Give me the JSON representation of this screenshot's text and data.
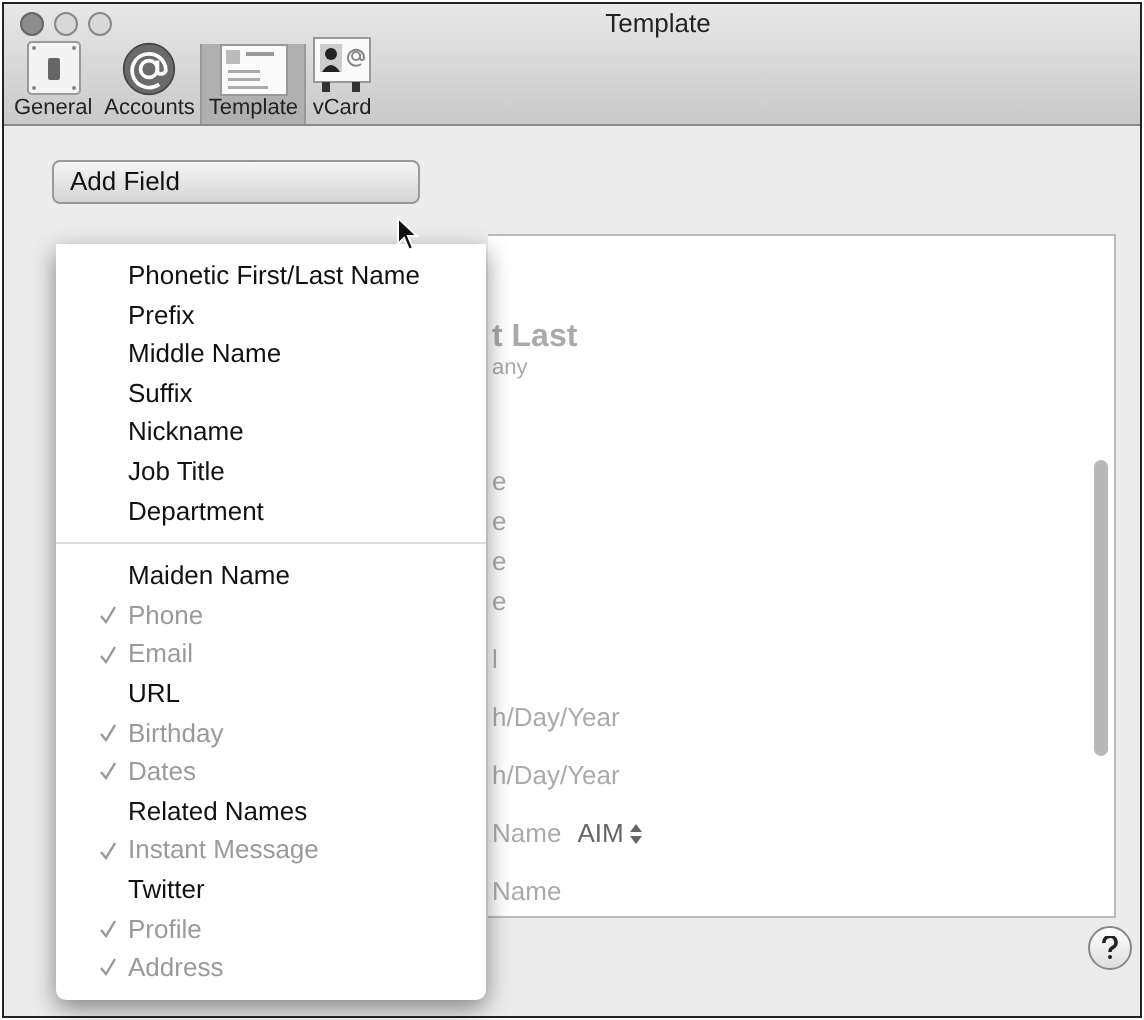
{
  "window": {
    "title": "Template"
  },
  "toolbar": [
    {
      "label": "General",
      "kind": "switch",
      "selected": false
    },
    {
      "label": "Accounts",
      "kind": "at",
      "selected": false
    },
    {
      "label": "Template",
      "kind": "card",
      "selected": true
    },
    {
      "label": "vCard",
      "kind": "vcard",
      "selected": false
    }
  ],
  "add_field": {
    "label": "Add Field"
  },
  "menu": {
    "sections": [
      [
        {
          "label": "Phonetic First/Last Name",
          "checked": false
        },
        {
          "label": "Prefix",
          "checked": false
        },
        {
          "label": "Middle Name",
          "checked": false
        },
        {
          "label": "Suffix",
          "checked": false
        },
        {
          "label": "Nickname",
          "checked": false
        },
        {
          "label": "Job Title",
          "checked": false
        },
        {
          "label": "Department",
          "checked": false
        }
      ],
      [
        {
          "label": "Maiden Name",
          "checked": false
        },
        {
          "label": "Phone",
          "checked": true
        },
        {
          "label": "Email",
          "checked": true
        },
        {
          "label": "URL",
          "checked": false
        },
        {
          "label": "Birthday",
          "checked": true
        },
        {
          "label": "Dates",
          "checked": true
        },
        {
          "label": "Related Names",
          "checked": false
        },
        {
          "label": "Instant Message",
          "checked": true
        },
        {
          "label": "Twitter",
          "checked": false
        },
        {
          "label": "Profile",
          "checked": true
        },
        {
          "label": "Address",
          "checked": true
        }
      ]
    ]
  },
  "card": {
    "title": "t Last",
    "subtitle": "any",
    "groups": [
      [
        {
          "text": "e"
        },
        {
          "text": "e"
        },
        {
          "text": "e"
        },
        {
          "text": "e"
        }
      ],
      [
        {
          "text": "l"
        }
      ],
      [
        {
          "text": "h/Day/Year"
        }
      ],
      [
        {
          "text": "h/Day/Year"
        }
      ],
      [
        {
          "text": "Name",
          "popup": "AIM"
        }
      ],
      [
        {
          "text": "Name"
        }
      ]
    ]
  }
}
